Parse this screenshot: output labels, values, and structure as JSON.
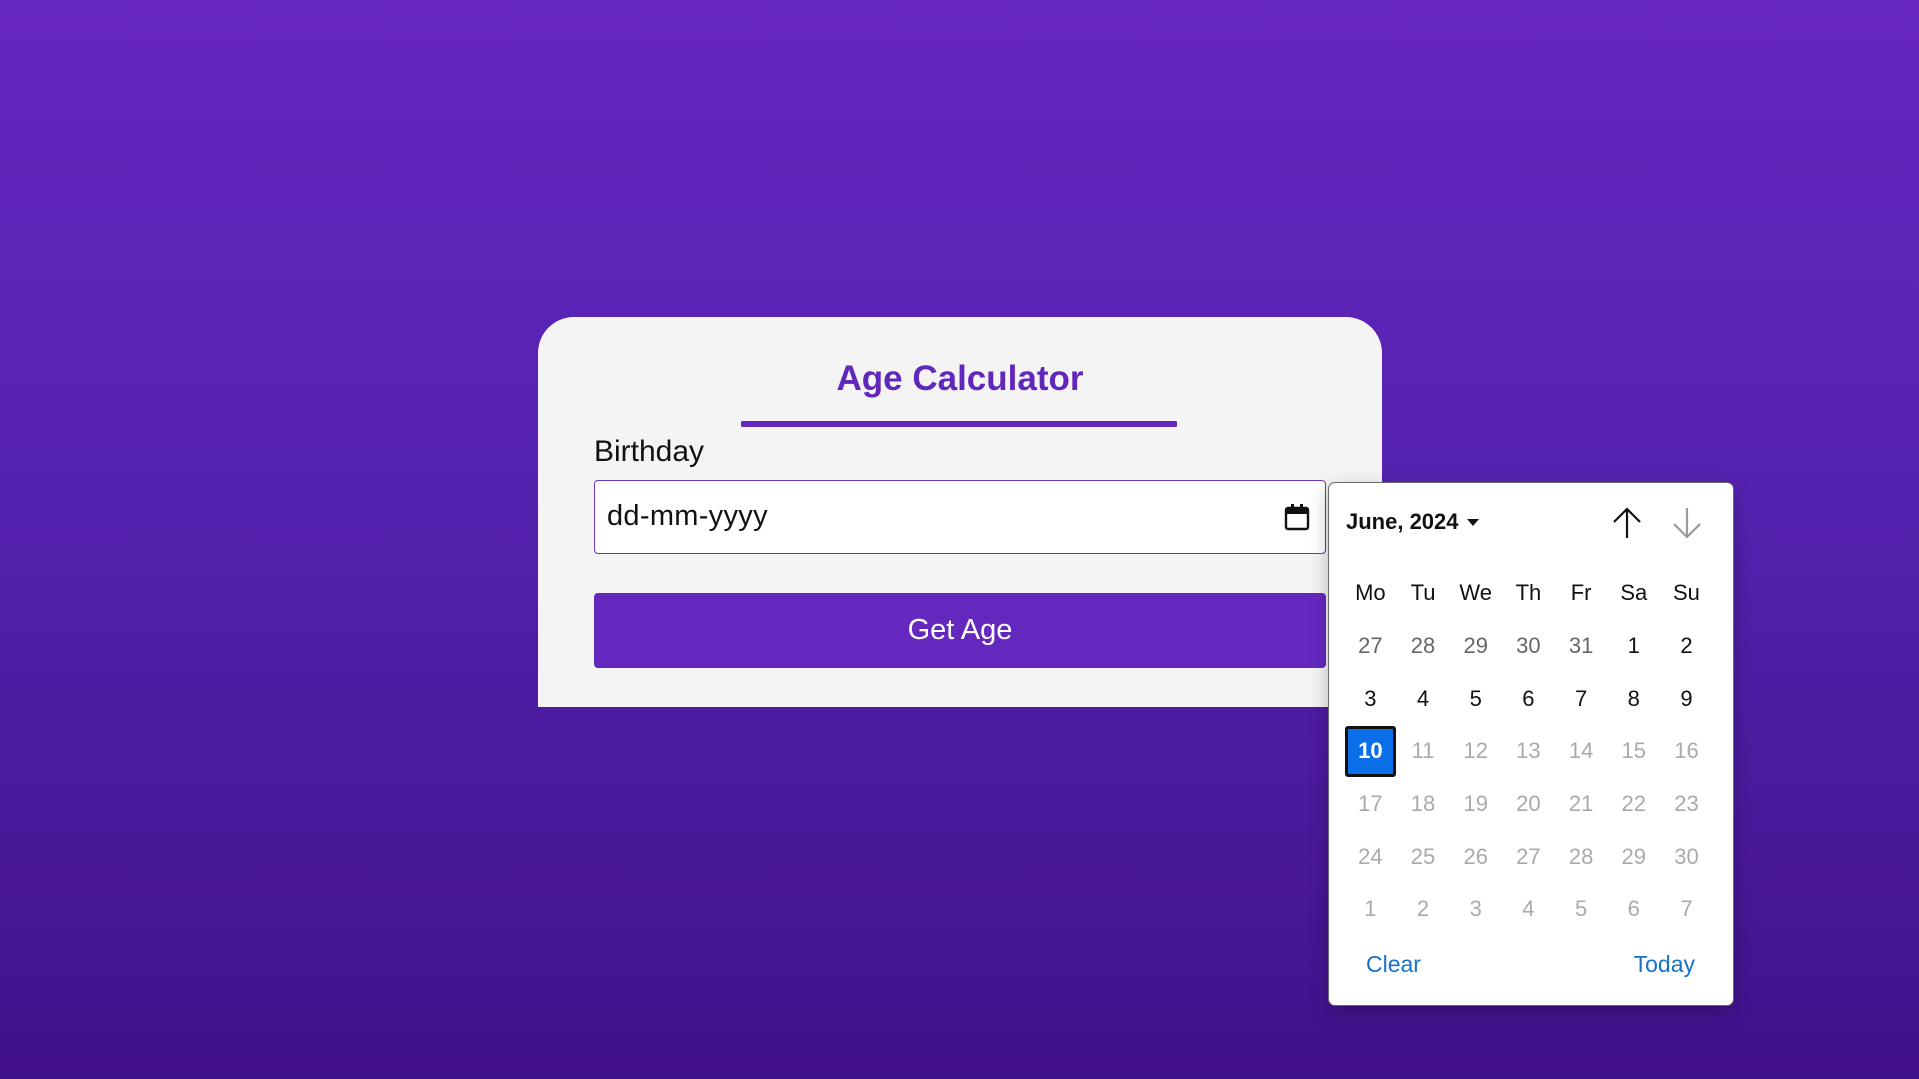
{
  "card": {
    "title": "Age Calculator",
    "birthday_label": "Birthday",
    "date_placeholder": "dd-mm-yyyy",
    "button_label": "Get Age"
  },
  "picker": {
    "month_label": "June, 2024",
    "weekdays": [
      "Mo",
      "Tu",
      "We",
      "Th",
      "Fr",
      "Sa",
      "Su"
    ],
    "days": [
      {
        "label": "27",
        "state": "other"
      },
      {
        "label": "28",
        "state": "other"
      },
      {
        "label": "29",
        "state": "other"
      },
      {
        "label": "30",
        "state": "other"
      },
      {
        "label": "31",
        "state": "other"
      },
      {
        "label": "1",
        "state": "normal"
      },
      {
        "label": "2",
        "state": "normal"
      },
      {
        "label": "3",
        "state": "normal"
      },
      {
        "label": "4",
        "state": "normal"
      },
      {
        "label": "5",
        "state": "normal"
      },
      {
        "label": "6",
        "state": "normal"
      },
      {
        "label": "7",
        "state": "normal"
      },
      {
        "label": "8",
        "state": "normal"
      },
      {
        "label": "9",
        "state": "normal"
      },
      {
        "label": "10",
        "state": "today"
      },
      {
        "label": "11",
        "state": "disabled"
      },
      {
        "label": "12",
        "state": "disabled"
      },
      {
        "label": "13",
        "state": "disabled"
      },
      {
        "label": "14",
        "state": "disabled"
      },
      {
        "label": "15",
        "state": "disabled"
      },
      {
        "label": "16",
        "state": "disabled"
      },
      {
        "label": "17",
        "state": "disabled"
      },
      {
        "label": "18",
        "state": "disabled"
      },
      {
        "label": "19",
        "state": "disabled"
      },
      {
        "label": "20",
        "state": "disabled"
      },
      {
        "label": "21",
        "state": "disabled"
      },
      {
        "label": "22",
        "state": "disabled"
      },
      {
        "label": "23",
        "state": "disabled"
      },
      {
        "label": "24",
        "state": "disabled"
      },
      {
        "label": "25",
        "state": "disabled"
      },
      {
        "label": "26",
        "state": "disabled"
      },
      {
        "label": "27",
        "state": "disabled"
      },
      {
        "label": "28",
        "state": "disabled"
      },
      {
        "label": "29",
        "state": "disabled"
      },
      {
        "label": "30",
        "state": "disabled"
      },
      {
        "label": "1",
        "state": "disabled"
      },
      {
        "label": "2",
        "state": "disabled"
      },
      {
        "label": "3",
        "state": "disabled"
      },
      {
        "label": "4",
        "state": "disabled"
      },
      {
        "label": "5",
        "state": "disabled"
      },
      {
        "label": "6",
        "state": "disabled"
      },
      {
        "label": "7",
        "state": "disabled"
      }
    ],
    "clear_label": "Clear",
    "today_label": "Today"
  },
  "icons": {
    "calendar": "calendar-icon",
    "month_dropdown": "caret-down-icon",
    "prev": "arrow-up-icon",
    "next": "arrow-down-icon"
  },
  "colors": {
    "accent": "#6528bf",
    "selected_day": "#0a6fe8",
    "link": "#1672cc"
  }
}
